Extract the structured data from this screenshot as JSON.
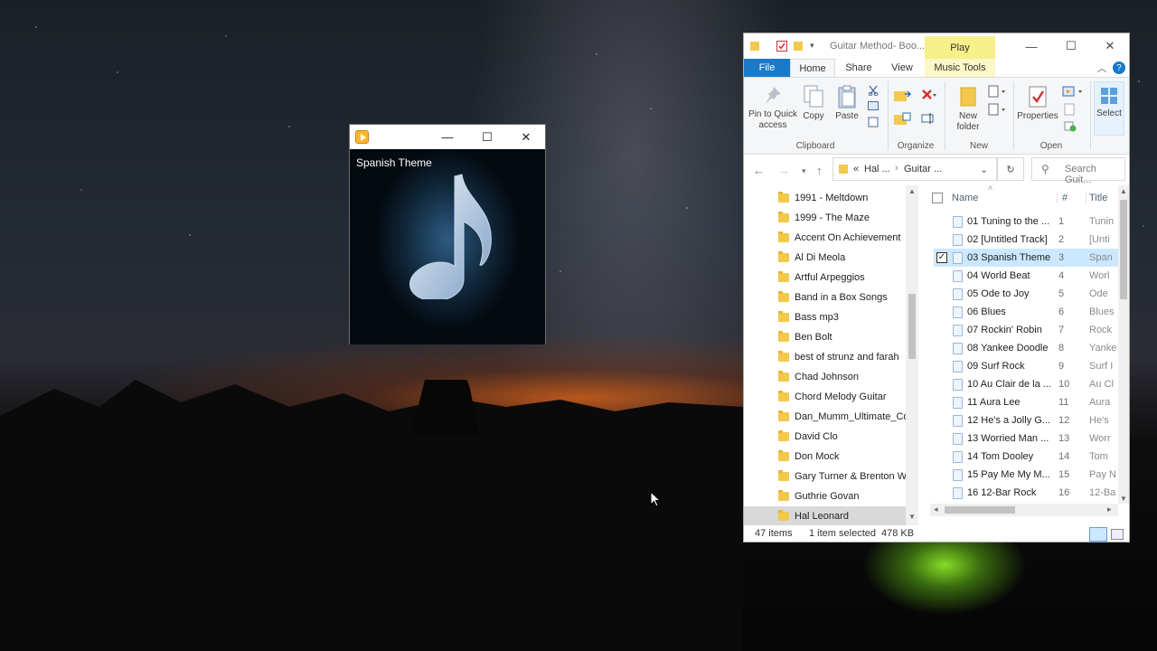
{
  "media_player": {
    "track_title": "Spanish Theme",
    "controls": {
      "minimize": "—",
      "maximize": "☐",
      "close": "✕"
    }
  },
  "explorer": {
    "window_title": "Guitar Method- Boo...",
    "contextual_tab": "Play",
    "controls": {
      "minimize": "—",
      "maximize": "☐",
      "close": "✕"
    },
    "tabs": [
      {
        "label": "File"
      },
      {
        "label": "Home"
      },
      {
        "label": "Share"
      },
      {
        "label": "View"
      },
      {
        "label": "Music Tools"
      }
    ],
    "ribbon": {
      "pin_label": "Pin to Quick access",
      "copy_label": "Copy",
      "paste_label": "Paste",
      "new_folder_label": "New folder",
      "properties_label": "Properties",
      "select_label": "Select",
      "groups": [
        "Clipboard",
        "Organize",
        "New",
        "Open"
      ]
    },
    "address": {
      "segments": [
        "«",
        "Hal ...",
        "›",
        "Guitar ..."
      ],
      "search_placeholder": "Search Guit..."
    },
    "nav_folders": [
      "1991 - Meltdown",
      "1999 - The Maze",
      "Accent On Achievement",
      "Al Di Meola",
      "Artful Arpeggios",
      "Band in a Box Songs",
      "Bass mp3",
      "Ben Bolt",
      "best of strunz and farah",
      "Chad Johnson",
      "Chord Melody Guitar",
      "Dan_Mumm_Ultimate_Co",
      "David Clo",
      "Don Mock",
      "Gary Turner & Brenton W",
      "Guthrie Govan",
      "Hal Leonard"
    ],
    "columns": {
      "name": "Name",
      "number": "#",
      "title": "Title"
    },
    "files": [
      {
        "name": "01 Tuning to the ...",
        "num": "1",
        "title": "Tunin"
      },
      {
        "name": "02 [Untitled Track]",
        "num": "2",
        "title": "[Unti"
      },
      {
        "name": "03 Spanish Theme",
        "num": "3",
        "title": "Span"
      },
      {
        "name": "04 World Beat",
        "num": "4",
        "title": "Worl"
      },
      {
        "name": "05 Ode to Joy",
        "num": "5",
        "title": "Ode"
      },
      {
        "name": "06 Blues",
        "num": "6",
        "title": "Blues"
      },
      {
        "name": "07 Rockin' Robin",
        "num": "7",
        "title": "Rock"
      },
      {
        "name": "08 Yankee Doodle",
        "num": "8",
        "title": "Yanke"
      },
      {
        "name": "09 Surf Rock",
        "num": "9",
        "title": "Surf I"
      },
      {
        "name": "10 Au Clair de la ...",
        "num": "10",
        "title": "Au Cl"
      },
      {
        "name": "11 Aura Lee",
        "num": "11",
        "title": "Aura"
      },
      {
        "name": "12 He's a Jolly G...",
        "num": "12",
        "title": "He's"
      },
      {
        "name": "13 Worried Man ...",
        "num": "13",
        "title": "Worr"
      },
      {
        "name": "14 Tom Dooley",
        "num": "14",
        "title": "Tom"
      },
      {
        "name": "15 Pay Me My M...",
        "num": "15",
        "title": "Pay N"
      },
      {
        "name": "16 12-Bar Rock",
        "num": "16",
        "title": "12-Ba"
      }
    ],
    "status": {
      "items": "47 items",
      "selected": "1 item selected",
      "size": "478 KB"
    }
  },
  "colors": {
    "file_tab": "#1979ca",
    "play_tab": "#f7f08a",
    "selection": "#cce8ff",
    "folder": "#f2c94c"
  }
}
